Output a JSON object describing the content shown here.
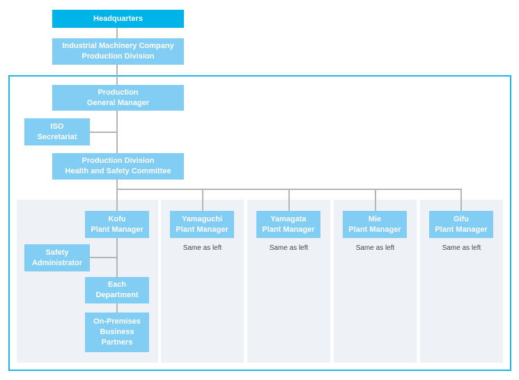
{
  "colors": {
    "headquarters": "#00b4ea",
    "node": "#82cdf3",
    "frame": "#1fb6e6",
    "panel": "#eef2f6",
    "connector": "#b5b5b5"
  },
  "headquarters": "Headquarters",
  "division": "Industrial Machinery Company\nProduction Division",
  "general_manager": "Production\nGeneral Manager",
  "iso": "ISO\nSecretariat",
  "committee": "Production Division\nHealth and Safety Committee",
  "kofu": {
    "manager": "Kofu\nPlant Manager",
    "safety": "Safety\nAdministrator",
    "departments": "Each\nDepartment",
    "partners": "On-Premises\nBusiness\nPartners"
  },
  "plants": [
    {
      "manager": "Yamaguchi\nPlant Manager",
      "note": "Same as left"
    },
    {
      "manager": "Yamagata\nPlant Manager",
      "note": "Same as left"
    },
    {
      "manager": "Mie\nPlant Manager",
      "note": "Same as left"
    },
    {
      "manager": "Gifu\nPlant Manager",
      "note": "Same as left"
    }
  ]
}
